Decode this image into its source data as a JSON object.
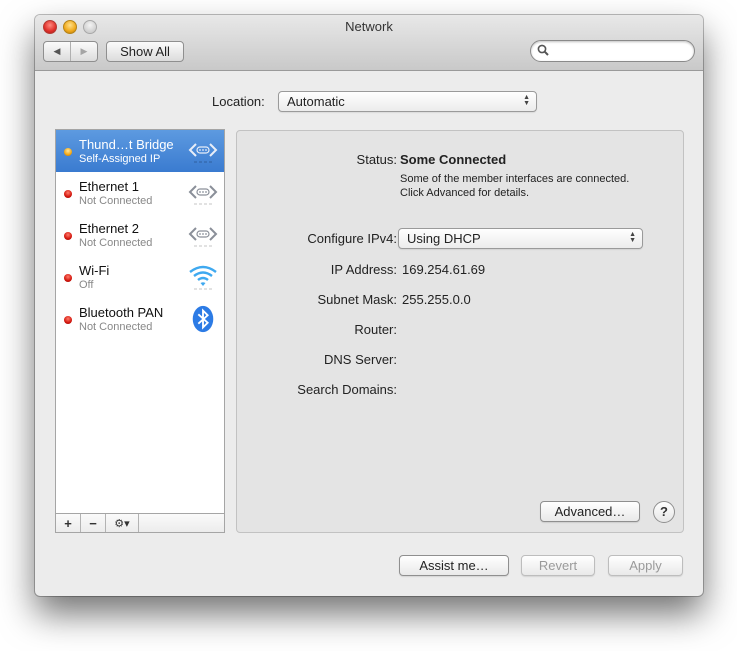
{
  "window": {
    "title": "Network",
    "controls": [
      "close",
      "minimize",
      "zoom"
    ]
  },
  "toolbar": {
    "back_icon": "◀",
    "forward_icon": "▶",
    "show_all_label": "Show All",
    "search_placeholder": "",
    "search_value": ""
  },
  "location": {
    "label": "Location:",
    "value": "Automatic"
  },
  "sidebar": {
    "services": [
      {
        "name": "Thund…t Bridge",
        "status": "Self-Assigned IP",
        "indicator": "yellow",
        "icon": "bridge-icon",
        "selected": true
      },
      {
        "name": "Ethernet 1",
        "status": "Not Connected",
        "indicator": "red",
        "icon": "ethernet-icon",
        "selected": false
      },
      {
        "name": "Ethernet 2",
        "status": "Not Connected",
        "indicator": "red",
        "icon": "ethernet-icon",
        "selected": false
      },
      {
        "name": "Wi-Fi",
        "status": "Off",
        "indicator": "red",
        "icon": "wifi-icon",
        "selected": false
      },
      {
        "name": "Bluetooth PAN",
        "status": "Not Connected",
        "indicator": "red",
        "icon": "bluetooth-icon",
        "selected": false
      }
    ],
    "add_label": "+",
    "remove_label": "−",
    "action_label": "⚙▾"
  },
  "detail": {
    "status_label": "Status:",
    "status_value": "Some Connected",
    "status_description": "Some of the member interfaces are connected. Click Advanced for details.",
    "configure_label": "Configure IPv4:",
    "configure_value": "Using DHCP",
    "ip_label": "IP Address:",
    "ip_value": "169.254.61.69",
    "subnet_label": "Subnet Mask:",
    "subnet_value": "255.255.0.0",
    "router_label": "Router:",
    "router_value": "",
    "dns_label": "DNS Server:",
    "dns_value": "",
    "search_domains_label": "Search Domains:",
    "search_domains_value": "",
    "advanced_label": "Advanced…",
    "help_label": "?"
  },
  "footer": {
    "assist_label": "Assist me…",
    "revert_label": "Revert",
    "apply_label": "Apply"
  },
  "colors": {
    "selection": "#3a7bd0",
    "indicator_red": "#d3150c",
    "indicator_yellow": "#f2a511"
  }
}
